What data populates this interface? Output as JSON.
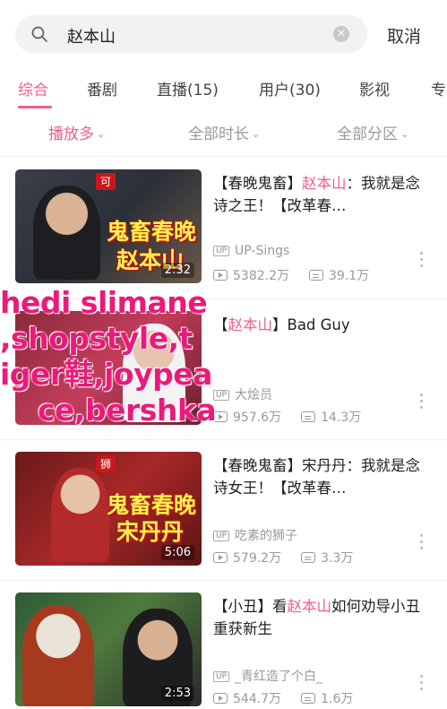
{
  "search": {
    "query": "赵本山",
    "cancel_label": "取消"
  },
  "tabs": [
    {
      "label": "综合"
    },
    {
      "label": "番剧"
    },
    {
      "label": "直播(15)"
    },
    {
      "label": "用户(30)"
    },
    {
      "label": "影视"
    },
    {
      "label": "专"
    }
  ],
  "filters": [
    {
      "label": "播放多"
    },
    {
      "label": "全部时长"
    },
    {
      "label": "全部分区"
    }
  ],
  "videos": [
    {
      "title_pre": "【春晚鬼畜】",
      "title_hl": "赵本山",
      "title_post": "：我就是念诗之王！【改革春…",
      "uploader": "UP-Sings",
      "plays": "5382.2万",
      "danmaku": "39.1万",
      "duration": "2:32",
      "thumb_tag": "可",
      "thumb_line1": "鬼畜春晚",
      "thumb_line2": "赵本山"
    },
    {
      "title_pre": "【",
      "title_hl": "赵本山",
      "title_post": "】Bad Guy",
      "uploader": "大烩员",
      "plays": "957.6万",
      "danmaku": "14.3万",
      "duration": ""
    },
    {
      "title_pre": "【春晚鬼畜】宋丹丹：我就是念诗女王！【改革春…",
      "title_hl": "",
      "title_post": "",
      "uploader": "吃素的狮子",
      "plays": "579.2万",
      "danmaku": "3.3万",
      "duration": "5:06",
      "thumb_tag": "狮",
      "thumb_line1": "鬼畜春晚",
      "thumb_line2": "宋丹丹"
    },
    {
      "title_pre": "【小丑】看",
      "title_hl": "赵本山",
      "title_post": "如何劝导小丑重获新生",
      "uploader": "_青红造了个白_",
      "plays": "544.7万",
      "danmaku": "1.6万",
      "duration": "2:53"
    }
  ],
  "watermark": {
    "line1": "hedi slimane",
    "line2": ",shopstyle,t",
    "line3": "iger鞋,joypea",
    "line4": "ce,bershka"
  },
  "colors": {
    "accent": "#f25d8e",
    "watermark": "#ea1a7a",
    "muted": "#999999"
  },
  "icons": [
    "search-icon",
    "clear-icon",
    "up-badge-icon",
    "play-count-icon",
    "danmaku-icon",
    "more-icon"
  ]
}
